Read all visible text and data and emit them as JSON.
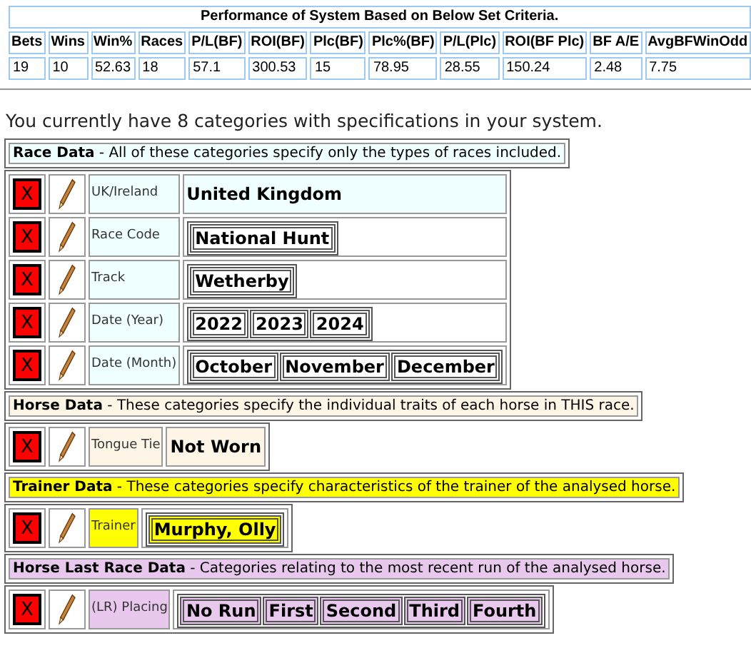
{
  "performance": {
    "title": "Performance of System Based on Below Set Criteria.",
    "columns": [
      "Bets",
      "Wins",
      "Win%",
      "Races",
      "P/L(BF)",
      "ROI(BF)",
      "Plc(BF)",
      "Plc%(BF)",
      "P/L(Plc)",
      "ROI(BF Plc)",
      "BF A/E",
      "AvgBFWinOdd"
    ],
    "values": [
      "19",
      "10",
      "52.63",
      "18",
      "57.1",
      "300.53",
      "15",
      "78.95",
      "28.55",
      "150.24",
      "2.48",
      "7.75"
    ]
  },
  "summary": "You currently have 8 categories with specifications in your system.",
  "sections": [
    {
      "title": "Race Data",
      "description": "- All of these categories specify only the types of races included.",
      "color": "#f0ffff",
      "rows": [
        {
          "delete": "X",
          "label": "UK/Ireland",
          "kind": "plain",
          "values": [
            "United Kingdom"
          ]
        },
        {
          "delete": "X",
          "label": "Race Code",
          "kind": "boxed",
          "values": [
            "National Hunt"
          ]
        },
        {
          "delete": "X",
          "label": "Track",
          "kind": "boxed",
          "values": [
            "Wetherby"
          ]
        },
        {
          "delete": "X",
          "label": "Date (Year)",
          "kind": "boxed",
          "values": [
            "2022",
            "2023",
            "2024"
          ]
        },
        {
          "delete": "X",
          "label": "Date (Month)",
          "kind": "boxed",
          "values": [
            "October",
            "November",
            "December"
          ]
        }
      ]
    },
    {
      "title": "Horse Data",
      "description": "- These categories specify the individual traits of each horse in THIS race.",
      "color": "#fdf5e6",
      "rows": [
        {
          "delete": "X",
          "label": "Tongue Tie",
          "kind": "plain",
          "values": [
            "Not Worn"
          ]
        }
      ]
    },
    {
      "title": "Trainer Data",
      "description": "- These categories specify characteristics of the trainer of the analysed horse.",
      "color": "#ffff00",
      "rows": [
        {
          "delete": "X",
          "label": "Trainer",
          "kind": "boxed",
          "values": [
            "Murphy, Olly"
          ]
        }
      ]
    },
    {
      "title": "Horse Last Race Data",
      "description": "- Categories relating to the most recent run of the analysed horse.",
      "color": "#e8c8ec",
      "rows": [
        {
          "delete": "X",
          "label": "(LR) Placing",
          "kind": "boxed",
          "values": [
            "No Run",
            "First",
            "Second",
            "Third",
            "Fourth"
          ]
        }
      ]
    }
  ]
}
